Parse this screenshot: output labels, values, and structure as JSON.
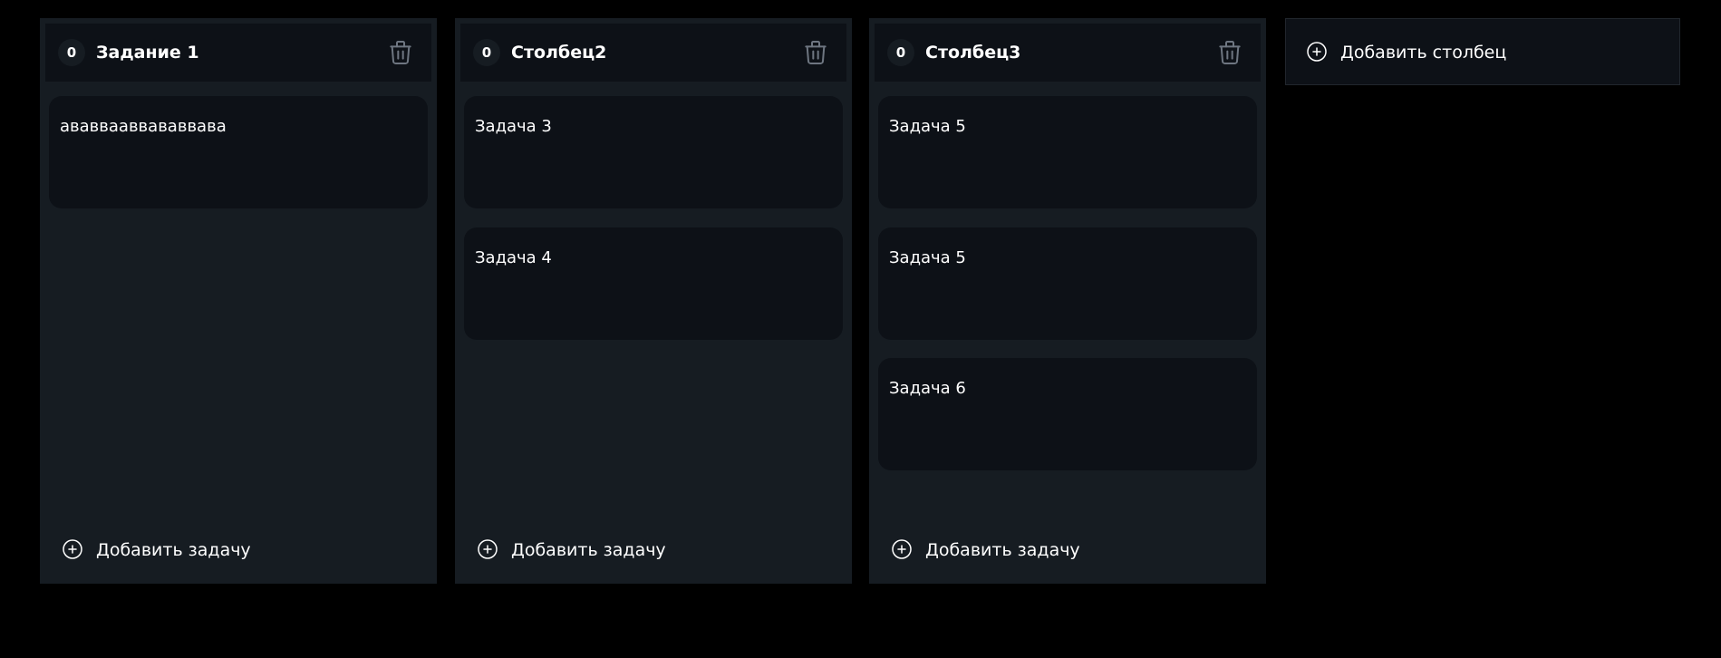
{
  "columns": [
    {
      "count": "0",
      "title": "Задание 1",
      "tasks": [
        "ававвааввававвава"
      ],
      "add_task_label": "Добавить задачу"
    },
    {
      "count": "0",
      "title": "Столбец2",
      "tasks": [
        "Задача 3",
        "Задача 4"
      ],
      "add_task_label": "Добавить задачу"
    },
    {
      "count": "0",
      "title": "Столбец3",
      "tasks": [
        "Задача 5",
        "Задача 5",
        "Задача 6"
      ],
      "add_task_label": "Добавить задачу"
    }
  ],
  "add_column_label": "Добавить столбец",
  "icons": {
    "delete": "trash-icon",
    "add": "plus-circle-icon"
  },
  "colors": {
    "page_background": "#000000",
    "column_background": "#161c22",
    "card_background": "#0d1117",
    "text": "#ffffff",
    "muted_icon": "#6e7681"
  }
}
